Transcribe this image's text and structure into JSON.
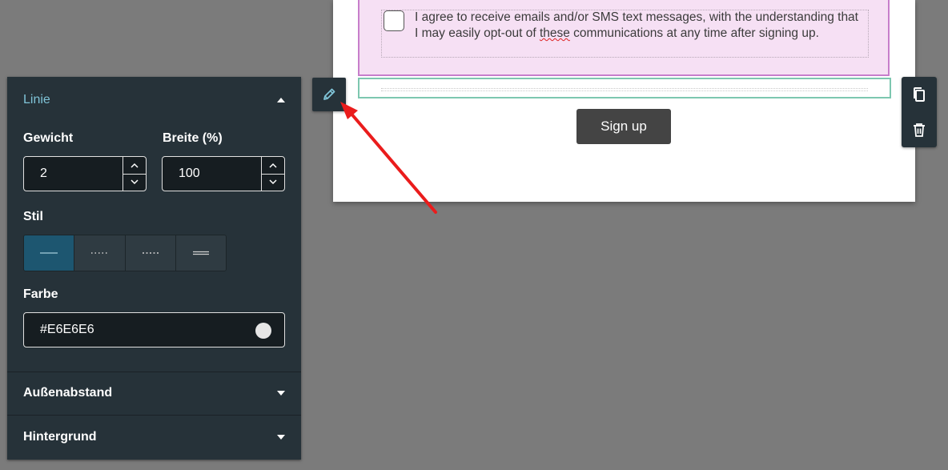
{
  "canvas": {
    "consent_text_before": "I agree to receive emails and/or SMS text messages, with the understanding that I may easily opt-out of ",
    "consent_text_spell": "these",
    "consent_text_after": " communications at any time after signing up.",
    "signup_label": "Sign up"
  },
  "panel": {
    "line_section": "Linie",
    "weight_label": "Gewicht",
    "weight_value": "2",
    "width_label": "Breite (%)",
    "width_value": "100",
    "style_label": "Stil",
    "style_options": [
      "solid-line-icon",
      "dotted-line-icon",
      "dashed-line-icon",
      "double-line-icon"
    ],
    "style_selected": "solid",
    "color_label": "Farbe",
    "color_value": "#E6E6E6",
    "margin_section": "Außenabstand",
    "background_section": "Hintergrund"
  },
  "tools": {
    "edit_icon": "pencil-icon",
    "copy_icon": "copy-icon",
    "delete_icon": "trash-icon"
  },
  "colors": {
    "panel_bg": "#263239",
    "accent": "#7fc3d7",
    "selected_style": "#1d5670",
    "annotation_arrow": "#ea1c1c",
    "consent_bg": "#f6e0f4",
    "consent_border": "#c77ecb",
    "divider_border": "#7dc7b0"
  }
}
